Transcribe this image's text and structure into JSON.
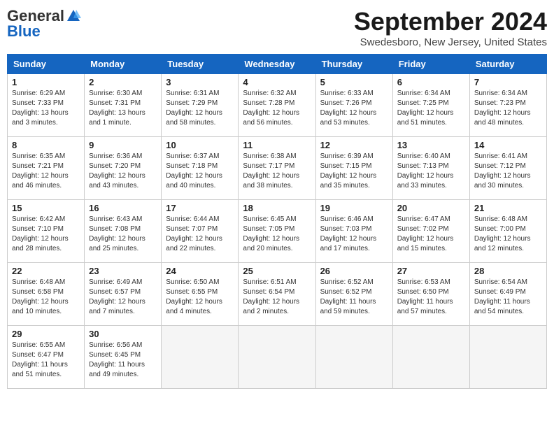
{
  "header": {
    "logo_general": "General",
    "logo_blue": "Blue",
    "month_title": "September 2024",
    "location": "Swedesboro, New Jersey, United States"
  },
  "weekdays": [
    "Sunday",
    "Monday",
    "Tuesday",
    "Wednesday",
    "Thursday",
    "Friday",
    "Saturday"
  ],
  "weeks": [
    [
      {
        "day": "1",
        "sunrise": "6:29 AM",
        "sunset": "7:33 PM",
        "daylight": "13 hours and 3 minutes."
      },
      {
        "day": "2",
        "sunrise": "6:30 AM",
        "sunset": "7:31 PM",
        "daylight": "13 hours and 1 minute."
      },
      {
        "day": "3",
        "sunrise": "6:31 AM",
        "sunset": "7:29 PM",
        "daylight": "12 hours and 58 minutes."
      },
      {
        "day": "4",
        "sunrise": "6:32 AM",
        "sunset": "7:28 PM",
        "daylight": "12 hours and 56 minutes."
      },
      {
        "day": "5",
        "sunrise": "6:33 AM",
        "sunset": "7:26 PM",
        "daylight": "12 hours and 53 minutes."
      },
      {
        "day": "6",
        "sunrise": "6:34 AM",
        "sunset": "7:25 PM",
        "daylight": "12 hours and 51 minutes."
      },
      {
        "day": "7",
        "sunrise": "6:34 AM",
        "sunset": "7:23 PM",
        "daylight": "12 hours and 48 minutes."
      }
    ],
    [
      {
        "day": "8",
        "sunrise": "6:35 AM",
        "sunset": "7:21 PM",
        "daylight": "12 hours and 46 minutes."
      },
      {
        "day": "9",
        "sunrise": "6:36 AM",
        "sunset": "7:20 PM",
        "daylight": "12 hours and 43 minutes."
      },
      {
        "day": "10",
        "sunrise": "6:37 AM",
        "sunset": "7:18 PM",
        "daylight": "12 hours and 40 minutes."
      },
      {
        "day": "11",
        "sunrise": "6:38 AM",
        "sunset": "7:17 PM",
        "daylight": "12 hours and 38 minutes."
      },
      {
        "day": "12",
        "sunrise": "6:39 AM",
        "sunset": "7:15 PM",
        "daylight": "12 hours and 35 minutes."
      },
      {
        "day": "13",
        "sunrise": "6:40 AM",
        "sunset": "7:13 PM",
        "daylight": "12 hours and 33 minutes."
      },
      {
        "day": "14",
        "sunrise": "6:41 AM",
        "sunset": "7:12 PM",
        "daylight": "12 hours and 30 minutes."
      }
    ],
    [
      {
        "day": "15",
        "sunrise": "6:42 AM",
        "sunset": "7:10 PM",
        "daylight": "12 hours and 28 minutes."
      },
      {
        "day": "16",
        "sunrise": "6:43 AM",
        "sunset": "7:08 PM",
        "daylight": "12 hours and 25 minutes."
      },
      {
        "day": "17",
        "sunrise": "6:44 AM",
        "sunset": "7:07 PM",
        "daylight": "12 hours and 22 minutes."
      },
      {
        "day": "18",
        "sunrise": "6:45 AM",
        "sunset": "7:05 PM",
        "daylight": "12 hours and 20 minutes."
      },
      {
        "day": "19",
        "sunrise": "6:46 AM",
        "sunset": "7:03 PM",
        "daylight": "12 hours and 17 minutes."
      },
      {
        "day": "20",
        "sunrise": "6:47 AM",
        "sunset": "7:02 PM",
        "daylight": "12 hours and 15 minutes."
      },
      {
        "day": "21",
        "sunrise": "6:48 AM",
        "sunset": "7:00 PM",
        "daylight": "12 hours and 12 minutes."
      }
    ],
    [
      {
        "day": "22",
        "sunrise": "6:48 AM",
        "sunset": "6:58 PM",
        "daylight": "12 hours and 10 minutes."
      },
      {
        "day": "23",
        "sunrise": "6:49 AM",
        "sunset": "6:57 PM",
        "daylight": "12 hours and 7 minutes."
      },
      {
        "day": "24",
        "sunrise": "6:50 AM",
        "sunset": "6:55 PM",
        "daylight": "12 hours and 4 minutes."
      },
      {
        "day": "25",
        "sunrise": "6:51 AM",
        "sunset": "6:54 PM",
        "daylight": "12 hours and 2 minutes."
      },
      {
        "day": "26",
        "sunrise": "6:52 AM",
        "sunset": "6:52 PM",
        "daylight": "11 hours and 59 minutes."
      },
      {
        "day": "27",
        "sunrise": "6:53 AM",
        "sunset": "6:50 PM",
        "daylight": "11 hours and 57 minutes."
      },
      {
        "day": "28",
        "sunrise": "6:54 AM",
        "sunset": "6:49 PM",
        "daylight": "11 hours and 54 minutes."
      }
    ],
    [
      {
        "day": "29",
        "sunrise": "6:55 AM",
        "sunset": "6:47 PM",
        "daylight": "11 hours and 51 minutes."
      },
      {
        "day": "30",
        "sunrise": "6:56 AM",
        "sunset": "6:45 PM",
        "daylight": "11 hours and 49 minutes."
      },
      null,
      null,
      null,
      null,
      null
    ]
  ]
}
